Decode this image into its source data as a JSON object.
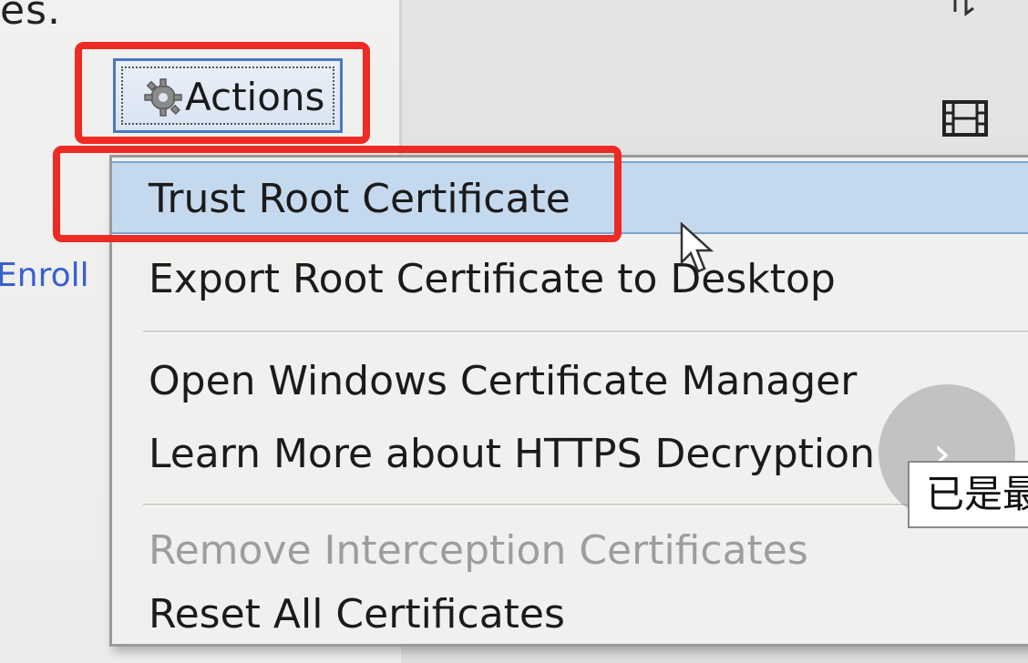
{
  "background": {
    "top_text": "es.",
    "enroll_link": "Enroll"
  },
  "actions_button": {
    "label": "Actions"
  },
  "menu": {
    "items": [
      {
        "label": "Trust Root Certificate",
        "state": "highlighted"
      },
      {
        "label": "Export Root Certificate to Desktop",
        "state": "normal"
      },
      {
        "label": "Open Windows Certificate Manager",
        "state": "normal"
      },
      {
        "label": "Learn More about HTTPS Decryption",
        "state": "normal"
      },
      {
        "label": "Remove Interception Certificates",
        "state": "disabled"
      },
      {
        "label": "Reset All Certificates",
        "state": "normal"
      }
    ]
  },
  "tooltip": {
    "text": "已是最"
  },
  "colors": {
    "highlight_box": "#ee2a24",
    "menu_highlight": "#c5d9ee",
    "link": "#3a5fd0",
    "disabled_text": "#9d9d9d"
  },
  "icons": {
    "actions": "gear-icon",
    "toolbar": "film-strip-icon",
    "next": "chevron-right-icon",
    "cursor": "mouse-pointer-icon"
  }
}
